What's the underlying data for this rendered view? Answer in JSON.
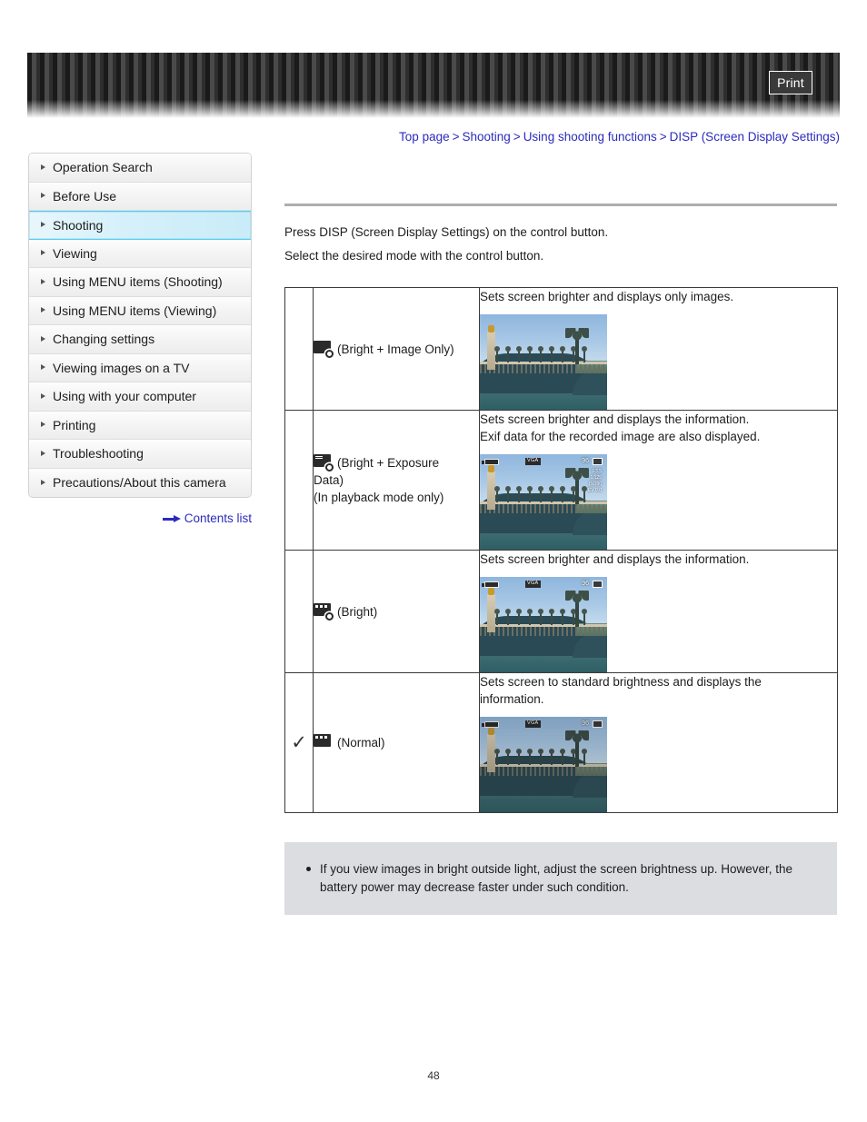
{
  "header": {
    "print_label": "Print"
  },
  "breadcrumb": {
    "items": [
      "Top page",
      "Shooting",
      "Using shooting functions",
      "DISP (Screen Display Settings)"
    ],
    "separator": ">"
  },
  "sidebar": {
    "items": [
      {
        "label": "Operation Search",
        "active": false
      },
      {
        "label": "Before Use",
        "active": false
      },
      {
        "label": "Shooting",
        "active": true
      },
      {
        "label": "Viewing",
        "active": false
      },
      {
        "label": "Using MENU items (Shooting)",
        "active": false
      },
      {
        "label": "Using MENU items (Viewing)",
        "active": false
      },
      {
        "label": "Changing settings",
        "active": false
      },
      {
        "label": "Viewing images on a TV",
        "active": false
      },
      {
        "label": "Using with your computer",
        "active": false
      },
      {
        "label": "Printing",
        "active": false
      },
      {
        "label": "Troubleshooting",
        "active": false
      },
      {
        "label": "Precautions/About this camera",
        "active": false
      }
    ],
    "contents_list_label": "Contents list"
  },
  "main": {
    "intro_line_1": "Press DISP (Screen Display Settings) on the control button.",
    "intro_line_2": "Select the desired mode with the control button.",
    "rows": [
      {
        "checked": false,
        "check_glyph": "",
        "icon": "disp-bright-image-only-icon",
        "mode_label": "(Bright + Image Only)",
        "mode_extra_1": "",
        "mode_extra_2": "",
        "desc_line_1": "Sets screen brighter and displays only images.",
        "desc_line_2": "",
        "thumb_overlay": false,
        "thumb_exif": false,
        "thumb_dim": false
      },
      {
        "checked": false,
        "check_glyph": "",
        "icon": "disp-bright-exposure-data-icon",
        "mode_label": "(Bright + Exposure",
        "mode_extra_1": "Data)",
        "mode_extra_2": "(In playback mode only)",
        "desc_line_1": "Sets screen brighter and displays the information.",
        "desc_line_2": "Exif data for the recorded image are also displayed.",
        "thumb_overlay": true,
        "thumb_exif": true,
        "thumb_dim": false
      },
      {
        "checked": false,
        "check_glyph": "",
        "icon": "disp-bright-icon",
        "mode_label": "(Bright)",
        "mode_extra_1": "",
        "mode_extra_2": "",
        "desc_line_1": "Sets screen brighter and displays the information.",
        "desc_line_2": "",
        "thumb_overlay": true,
        "thumb_exif": false,
        "thumb_dim": false
      },
      {
        "checked": true,
        "check_glyph": "✓",
        "icon": "disp-normal-icon",
        "mode_label": "(Normal)",
        "mode_extra_1": "",
        "mode_extra_2": "",
        "desc_line_1": "Sets screen to standard brightness and displays the",
        "desc_line_2": "information.",
        "thumb_overlay": true,
        "thumb_exif": false,
        "thumb_dim": true
      }
    ],
    "thumbnail_overlay": {
      "vga_label": "VGA",
      "count_label": "96",
      "exif_lines": [
        "F3.5",
        "1/125",
        "ISO80",
        "EV 0.0"
      ]
    }
  },
  "note": {
    "items": [
      "If you view images in bright outside light, adjust the screen brightness up. However, the battery power may decrease faster under such condition."
    ]
  },
  "footer": {
    "page_number": "48"
  },
  "colors": {
    "link": "#2b2bbd",
    "active_nav_border": "#55cdf0",
    "note_bg": "#dcdde1",
    "rule": "#aeaeae"
  }
}
